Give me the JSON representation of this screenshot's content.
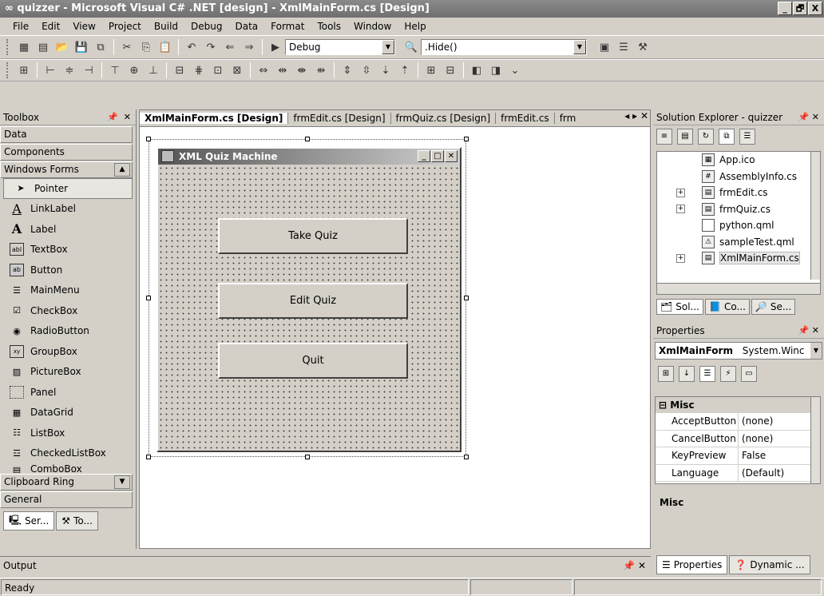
{
  "window": {
    "title": "quizzer - Microsoft Visual C# .NET [design] - XmlMainForm.cs [Design]",
    "buttons": [
      "_",
      "🗗",
      "X"
    ]
  },
  "menu": [
    "File",
    "Edit",
    "View",
    "Project",
    "Build",
    "Debug",
    "Data",
    "Format",
    "Tools",
    "Window",
    "Help"
  ],
  "toolbar": {
    "config_value": "Debug",
    "find_value": ".Hide()"
  },
  "toolbox": {
    "title": "Toolbox",
    "sections": [
      "Data",
      "Components",
      "Windows Forms"
    ],
    "items": [
      "Pointer",
      "LinkLabel",
      "Label",
      "TextBox",
      "Button",
      "MainMenu",
      "CheckBox",
      "RadioButton",
      "GroupBox",
      "PictureBox",
      "Panel",
      "DataGrid",
      "ListBox",
      "CheckedListBox",
      "ComboBox"
    ],
    "bottom_sections": [
      "Clipboard Ring",
      "General"
    ],
    "tabs": [
      "Ser...",
      "To..."
    ]
  },
  "doc_tabs": [
    "XmlMainForm.cs [Design]",
    "frmEdit.cs [Design]",
    "frmQuiz.cs [Design]",
    "frmEdit.cs",
    "frm"
  ],
  "form": {
    "title": "XML Quiz Machine",
    "buttons": [
      "Take Quiz",
      "Edit Quiz",
      "Quit"
    ]
  },
  "solution_explorer": {
    "title": "Solution Explorer - quizzer",
    "items": [
      {
        "label": "App.ico",
        "expand": false
      },
      {
        "label": "AssemblyInfo.cs",
        "expand": false
      },
      {
        "label": "frmEdit.cs",
        "expand": true
      },
      {
        "label": "frmQuiz.cs",
        "expand": true
      },
      {
        "label": "python.qml",
        "expand": false
      },
      {
        "label": "sampleTest.qml",
        "expand": false
      },
      {
        "label": "XmlMainForm.cs",
        "expand": true
      }
    ],
    "tabs": [
      "Sol...",
      "Co...",
      "Se..."
    ]
  },
  "properties": {
    "title": "Properties",
    "object_name": "XmlMainForm",
    "object_type": "System.Winc",
    "category": "Misc",
    "rows": [
      {
        "name": "AcceptButton",
        "value": "(none)"
      },
      {
        "name": "CancelButton",
        "value": "(none)"
      },
      {
        "name": "KeyPreview",
        "value": "False"
      },
      {
        "name": "Language",
        "value": "(Default)"
      }
    ],
    "description_title": "Misc",
    "bottom_tabs": [
      "Properties",
      "Dynamic ..."
    ]
  },
  "output": {
    "title": "Output"
  },
  "status": {
    "text": "Ready"
  }
}
